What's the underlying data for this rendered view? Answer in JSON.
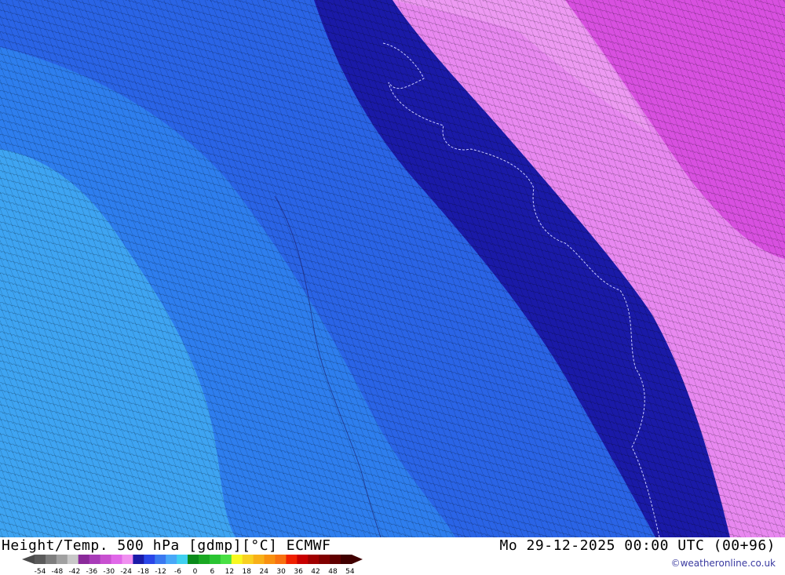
{
  "header": {
    "title": "Height/Temp. 500 hPa [gdmp][°C] ECMWF",
    "datetime": "Mo 29-12-2025 00:00 UTC (00+96)",
    "credit": "©weatheronline.co.uk"
  },
  "legend": {
    "ticks": [
      "-54",
      "-48",
      "-42",
      "-36",
      "-30",
      "-24",
      "-18",
      "-12",
      "-6",
      "0",
      "6",
      "12",
      "18",
      "24",
      "30",
      "36",
      "42",
      "48",
      "54"
    ],
    "colors": [
      "#5a5a5a",
      "#7d7d7d",
      "#a0a0a0",
      "#c8c8c8",
      "#8a2a9a",
      "#a83cb8",
      "#c850d0",
      "#e068e8",
      "#f090f0",
      "#1a1aa8",
      "#2a46e8",
      "#3a78f0",
      "#48a8f8",
      "#40d0f0",
      "#0a8a1a",
      "#1aa822",
      "#2ac432",
      "#48e044",
      "#f8f820",
      "#f8d020",
      "#f8b018",
      "#f89010",
      "#f87010",
      "#f02000",
      "#c80000",
      "#a00000",
      "#800000",
      "#600000",
      "#400000"
    ]
  },
  "map_layer": {
    "colors": {
      "background": "#2a64e6",
      "cyan_region": "#3ea4f2",
      "mid_blue": "#2e7eee",
      "dark_band": "#1a1aa8",
      "pink": "#e888f0",
      "magenta": "#d850e0"
    }
  }
}
